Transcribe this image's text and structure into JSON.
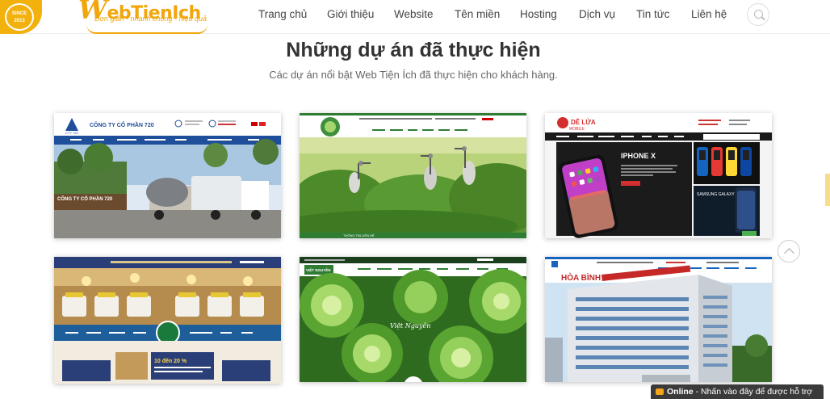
{
  "badge": {
    "line1": "SINCE",
    "line2": "2013"
  },
  "logo": {
    "w": "W",
    "rest": "ebTienIch",
    "tagline": "Đơn giản - nhanh chóng - hiệu quả"
  },
  "nav": [
    "Trang chủ",
    "Giới thiệu",
    "Website",
    "Tên miền",
    "Hosting",
    "Dịch vụ",
    "Tin tức",
    "Liên hệ"
  ],
  "section": {
    "title": "Những dự án đã thực hiện",
    "subtitle": "Các dự án nổi bật Web Tiện Ích đã thực hiện cho khách hàng."
  },
  "projects": {
    "p1": {
      "company": "CÔNG TY CỔ PHẦN 720",
      "logo_text": "CTY 720",
      "sign": "CÔNG TY CỔ PHẦN 720"
    },
    "p2": {
      "footer": "THÔNG TIN LIÊN HỆ"
    },
    "p3": {
      "brand": "DÊ LỬA",
      "brand_sub": "MOBILE",
      "product": "IPHONE X",
      "product2": "SAMSUNG GALAXY"
    },
    "p4": {
      "banner": "10 đến 20 %"
    },
    "p5": {
      "brand": "VIỆT NGUYÊN",
      "slogan": "Việt Nguyên"
    },
    "p6": {
      "brand": "HÒA BÌNH"
    }
  },
  "chat": {
    "status": "Online",
    "message": " - Nhấn vào đây để được hỗ trợ"
  },
  "colors": {
    "accent": "#f0a60c",
    "nav_text": "#444444",
    "chat_bg": "#3a3a3a"
  }
}
